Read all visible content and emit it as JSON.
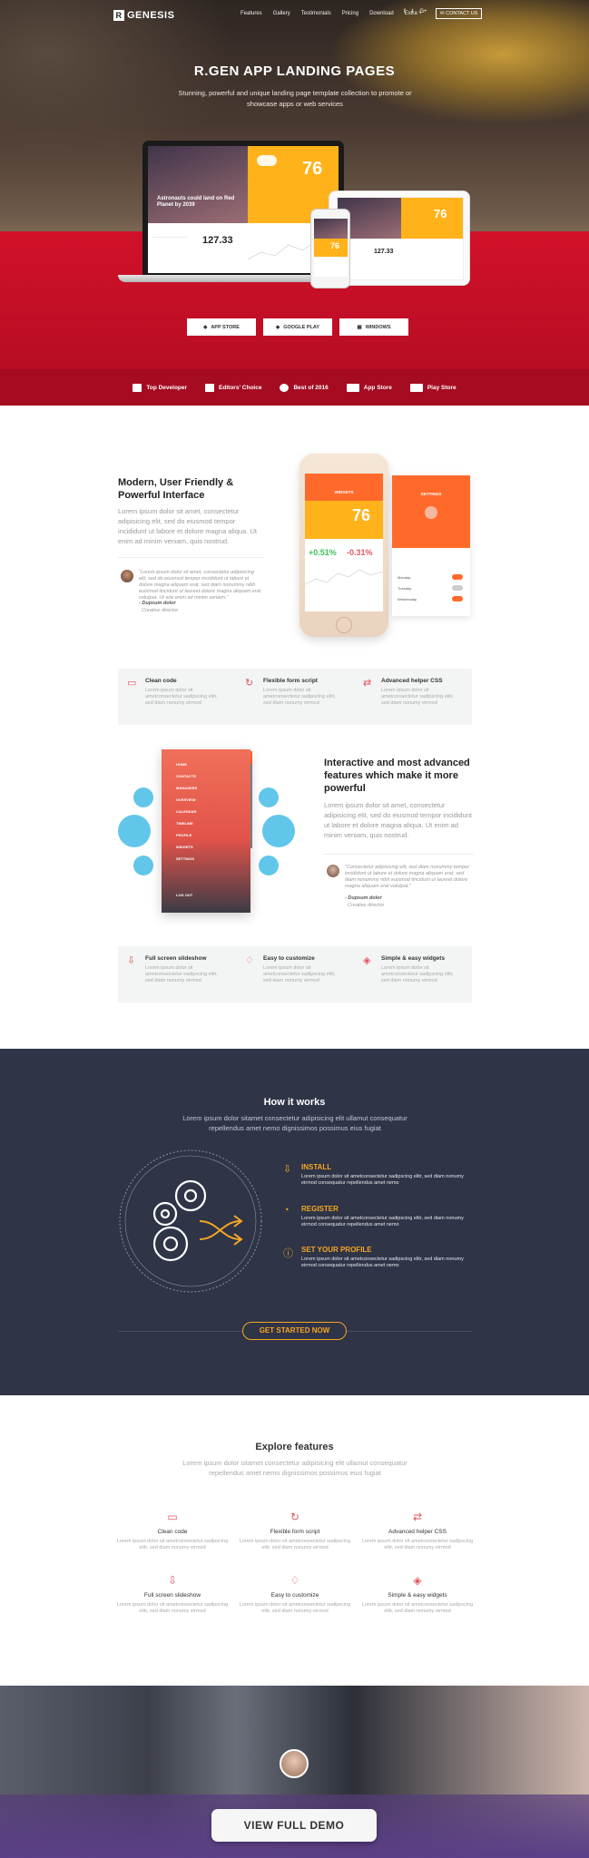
{
  "nav": {
    "logo_mark": "R",
    "logo_text": "GENESIS",
    "links": [
      "Features",
      "Gallery",
      "Testimonials",
      "Pricing",
      "Download",
      "Extra +"
    ],
    "social": [
      "f",
      "t",
      "G+"
    ],
    "contact_label": "CONTACT US"
  },
  "hero": {
    "title": "R.GEN APP LANDING PAGES",
    "subtitle": "Stunning, powerful and unique landing page template collection to promote or showcase apps or web services",
    "laptop_temp": "76",
    "laptop_headline": "Astronauts could land on Red Planet by 2039",
    "laptop_stat": "127.33",
    "tablet_temp": "76",
    "tablet_stat": "127.33",
    "phone_temp": "76",
    "store_buttons": [
      "APP STORE",
      "GOOGLE PLAY",
      "WINDOWS"
    ]
  },
  "awards": [
    "Top Developer",
    "Editors' Choice",
    "Best of 2016",
    "App Store",
    "Play Store"
  ],
  "section1": {
    "title": "Modern, User Friendly & Powerful Interface",
    "text": "Lorem ipsum dolor sit amet, consectetur adipisicing elit, sed do eiusmod tempor incididunt ut labore et dolore magna aliqua. Ut enim ad minim veniam, quis nostrud.",
    "quote": "\"Lorem ipsum dolor sit amet, consectetur adipisicing elit, sed do eiusmod tempor incididunt ut labore et dolore magna aliquam erat, sed diam nonummy nibh euismod tincidunt ut laoreet dolore magna aliquam erat volutpat. Ut wisi enim ad minim veniam.\"",
    "quote_name": "- Dupsum dolor",
    "quote_role": "Creative director",
    "phone_header": "WIDGETS",
    "phone_temp": "76",
    "phone_stat_a": "+0.51%",
    "phone_stat_b": "-0.31%",
    "settings_header": "SETTINGS",
    "settings_items": [
      "Monday",
      "Tuesday",
      "Wednesday"
    ]
  },
  "features1": [
    {
      "title": "Clean code",
      "desc": "Lorem ipsum dolor sit ametconsectetur sadipscing elitr, sed diam nonumy eirmod"
    },
    {
      "title": "Flexible form script",
      "desc": "Lorem ipsum dolor sit ametconsectetur sadipscing elitr, sed diam nonumy eirmod"
    },
    {
      "title": "Advanced helper CSS",
      "desc": "Lorem ipsum dolor sit ametconsectetur sadipscing elitr, sed diam nonumy eirmod"
    }
  ],
  "section2": {
    "title": "Interactive and most advanced features which make it more powerful",
    "text": "Lorem ipsum dolor sit amet, consectetur adipisicing elit, sed do eiusmod tempor incididunt ut labore et dolore magna aliqua. Ut enim ad minim veniam, quis nostrud.",
    "quote": "\"Consectetur adipisicing elit, sed diam nonummy tempor incididunt ut labore et dolore magna aliquam erat, sed diam nonummy nibh euismod tincidunt ut laoreet dolore magna aliquam erat volutpat.\"",
    "quote_name": "- Dupsum dolor",
    "quote_role": "Creative director",
    "menu_items": [
      "HOME",
      "CONTACTS",
      "MANAGERS",
      "OVERVIEW",
      "CALENDAR",
      "TIMELINE",
      "PROFILE",
      "WIDGETS",
      "SETTINGS"
    ],
    "menu_footer": "LOG OUT"
  },
  "features2": [
    {
      "title": "Full screen slideshow",
      "desc": "Lorem ipsum dolor sit ametconsectetur sadipscing elitr, sed diam nonumy eirmod"
    },
    {
      "title": "Easy to customize",
      "desc": "Lorem ipsum dolor sit ametconsectetur sadipscing elitr, sed diam nonumy eirmod"
    },
    {
      "title": "Simple & easy widgets",
      "desc": "Lorem ipsum dolor sit ametconsectetur sadipscing elitr, sed diam nonumy eirmod"
    }
  ],
  "how": {
    "title": "How it works",
    "subtitle": "Lorem ipsum dolor sitamet consectetur adipisicing elit ullamut consequatur repellendus amet nemo dignissimos possimus eius fugiat",
    "steps": [
      {
        "title": "INSTALL",
        "desc": "Lorem ipsum dolor sit ametconsectetur sadipscing elitr, sed diam nonumy eirmod consequatur repellendus amet nemo"
      },
      {
        "title": "REGISTER",
        "desc": "Lorem ipsum dolor sit ametconsectetur sadipscing elitr, sed diam nonumy eirmod consequatur repellendus amet nemo"
      },
      {
        "title": "SET YOUR PROFILE",
        "desc": "Lorem ipsum dolor sit ametconsectetur sadipscing elitr, sed diam nonumy eirmod consequatur repellendus amet nemo"
      }
    ],
    "cta": "GET STARTED NOW"
  },
  "explore": {
    "title": "Explore features",
    "subtitle": "Lorem ipsum dolor sitamet consectetur adipisicing elit ullamut consequatur repellendus amet nemo dignissimos possimus eius fugiat",
    "items": [
      {
        "title": "Clean code",
        "desc": "Lorem ipsum dolor sit ametconsectetur sadipscing elitr, sed diam nonumy eirmod"
      },
      {
        "title": "Flexible form script",
        "desc": "Lorem ipsum dolor sit ametconsectetur sadipscing elitr, sed diam nonumy eirmod"
      },
      {
        "title": "Advanced helper CSS",
        "desc": "Lorem ipsum dolor sit ametconsectetur sadipscing elitr, sed diam nonumy eirmod"
      },
      {
        "title": "Full screen slideshow",
        "desc": "Lorem ipsum dolor sit ametconsectetur sadipscing elitr, sed diam nonumy eirmod"
      },
      {
        "title": "Easy to customize",
        "desc": "Lorem ipsum dolor sit ametconsectetur sadipscing elitr, sed diam nonumy eirmod"
      },
      {
        "title": "Simple & easy widgets",
        "desc": "Lorem ipsum dolor sit ametconsectetur sadipscing elitr, sed diam nonumy eirmod"
      }
    ]
  },
  "demo_button": "VIEW FULL DEMO",
  "colors": {
    "accent": "#e2565f",
    "hero_red": "#c80f27",
    "dark": "#2f3447",
    "orange": "#f5a623",
    "weather": "#ffb21a"
  }
}
